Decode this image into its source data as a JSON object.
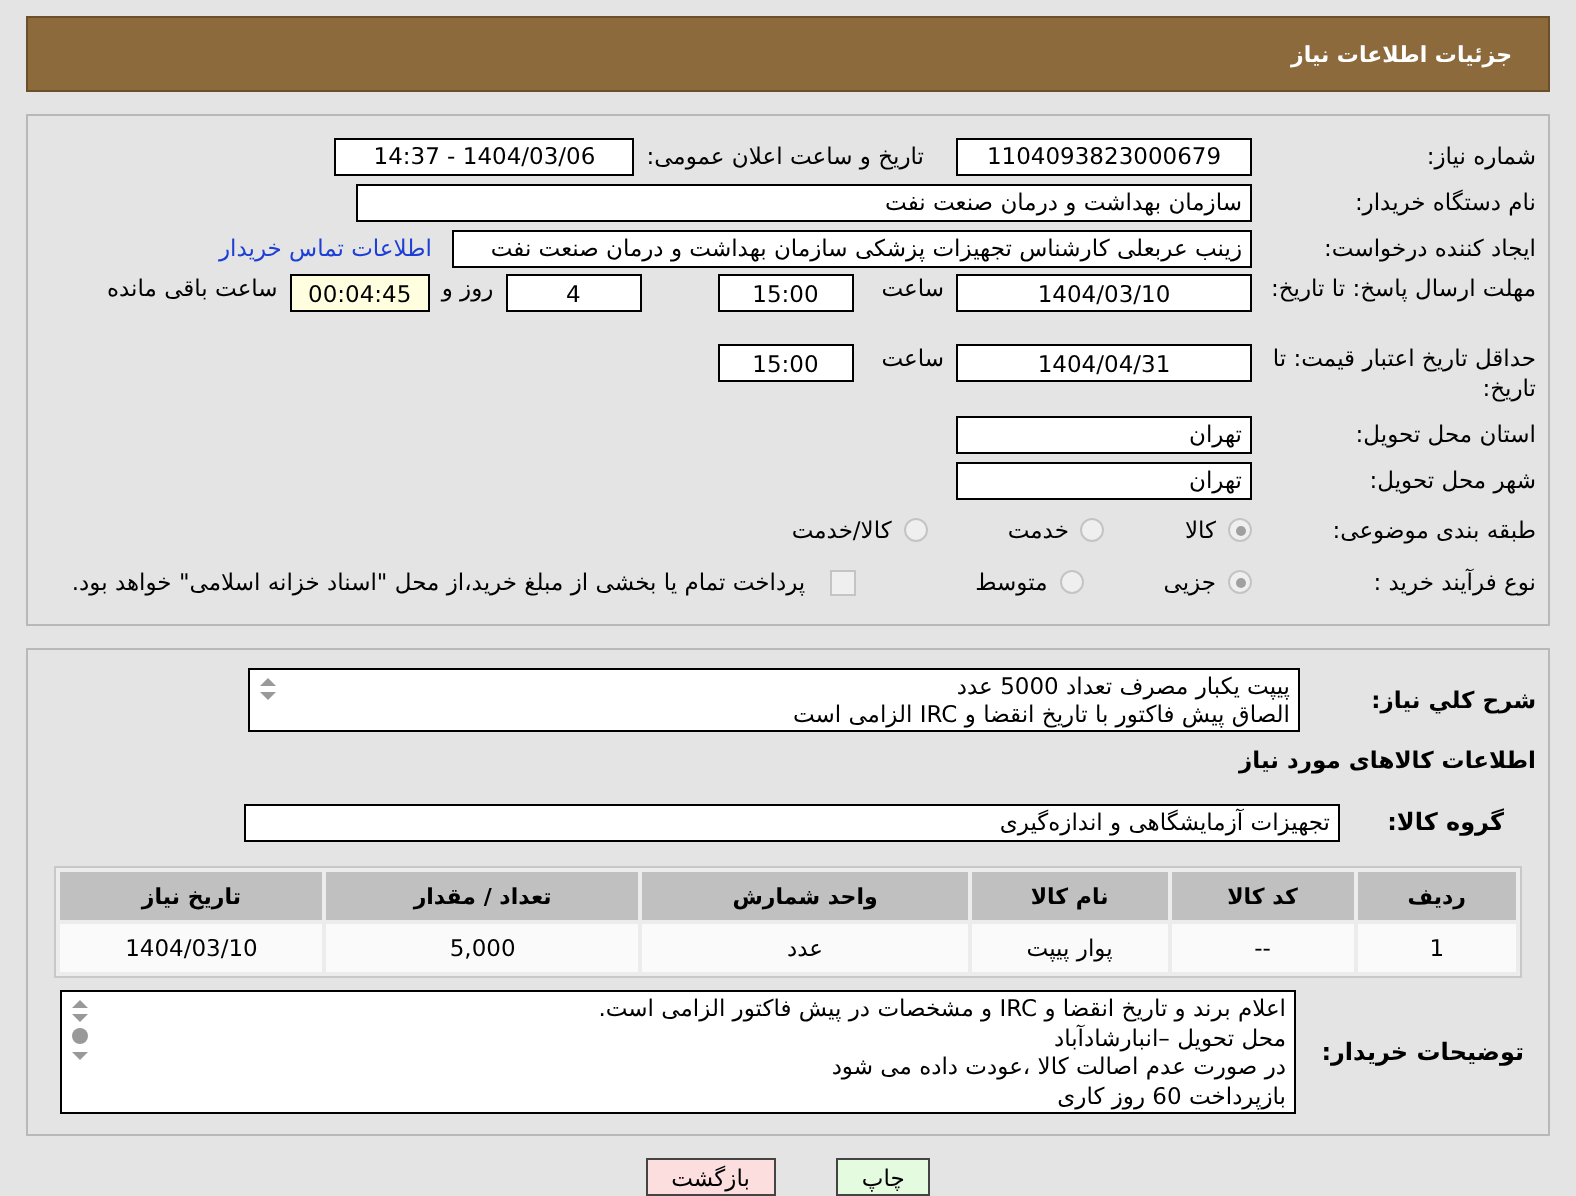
{
  "header": {
    "title": "جزئیات اطلاعات نیاز"
  },
  "need_number": {
    "label": "شماره نیاز:",
    "value": "1104093823000679"
  },
  "announce": {
    "label": "تاریخ و ساعت اعلان عمومی:",
    "value": "1404/03/06 - 14:37"
  },
  "buyer_org": {
    "label": "نام دستگاه خریدار:",
    "value": "سازمان بهداشت و درمان صنعت نفت"
  },
  "requester": {
    "label": "ایجاد کننده درخواست:",
    "value": "زینب عربعلی کارشناس تجهیزات پزشکی سازمان بهداشت و درمان صنعت نفت",
    "link": "اطلاعات تماس خریدار"
  },
  "reply_deadline": {
    "label": "مهلت ارسال پاسخ: تا تاریخ:",
    "date": "1404/03/10",
    "time_label": "ساعت",
    "time": "15:00",
    "days": "4",
    "days_label": "روز و",
    "remaining": "00:04:45",
    "remaining_label": "ساعت باقی مانده"
  },
  "price_validity": {
    "label": "حداقل تاریخ اعتبار قیمت: تا تاریخ:",
    "date": "1404/04/31",
    "time_label": "ساعت",
    "time": "15:00"
  },
  "province": {
    "label": "استان محل تحویل:",
    "value": "تهران"
  },
  "city": {
    "label": "شهر محل تحویل:",
    "value": "تهران"
  },
  "category": {
    "label": "طبقه بندی موضوعی:",
    "options": [
      {
        "label": "کالا",
        "selected": true
      },
      {
        "label": "خدمت",
        "selected": false
      },
      {
        "label": "کالا/خدمت",
        "selected": false
      }
    ]
  },
  "process": {
    "label": "نوع فرآیند خرید :",
    "options": [
      {
        "label": "جزیی",
        "selected": true
      },
      {
        "label": "متوسط",
        "selected": false
      }
    ],
    "payment_note": {
      "checked": false,
      "text": "پرداخت تمام یا بخشی از مبلغ خرید،از محل \"اسناد خزانه اسلامی\" خواهد بود."
    }
  },
  "description": {
    "label": "شرح کلي نياز:",
    "lines": [
      "پیپت یکبار مصرف تعداد 5000 عدد",
      "الصاق پیش فاکتور با تاریخ انقضا و IRC الزامی است"
    ]
  },
  "goods": {
    "title": "اطلاعات کالاهای مورد نیاز",
    "group": {
      "label": "گروه کالا:",
      "value": "تجهیزات آزمایشگاهی و اندازه‌گیری"
    },
    "columns": [
      "ردیف",
      "کد کالا",
      "نام کالا",
      "واحد شمارش",
      "تعداد / مقدار",
      "تاریخ نیاز"
    ],
    "rows": [
      [
        "1",
        "--",
        "پوار پیپت",
        "عدد",
        "5,000",
        "1404/03/10"
      ]
    ]
  },
  "buyer_notes": {
    "label": "توضیحات خریدار:",
    "lines": [
      "اعلام برند و تاریخ انقضا  و IRC  و مشخصات  در پیش فاکتور الزامی است.",
      "محل تحویل –انبارشادآباد",
      "در صورت عدم اصالت کالا ،عودت داده می شود",
      "بازپرداخت 60 روز کاری"
    ]
  },
  "buttons": [
    {
      "label": "چاپ",
      "kind": "print"
    },
    {
      "label": "بازگشت",
      "kind": "back"
    }
  ]
}
